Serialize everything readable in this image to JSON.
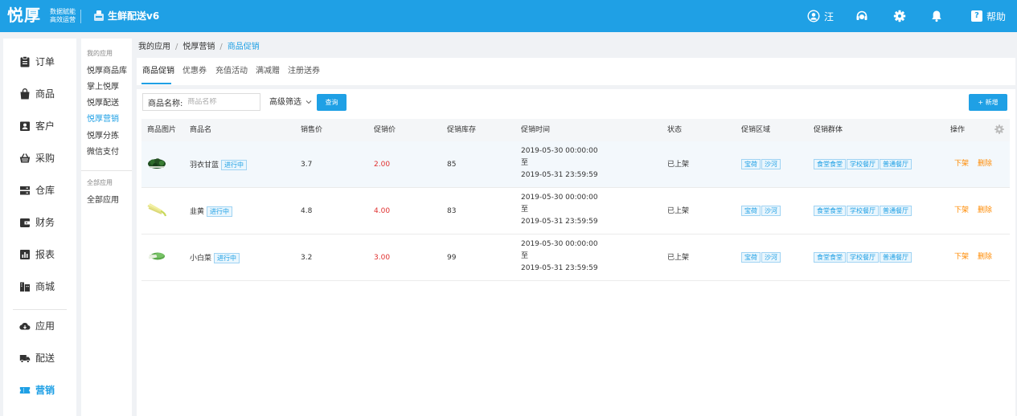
{
  "header": {
    "logo_text": "悦厚",
    "logo_slogan_1": "数据赋能",
    "logo_slogan_2": "高效运营",
    "app_title": "生鲜配送v6",
    "user_name": "汪",
    "help_label": "帮助",
    "help_badge": "?"
  },
  "sidebar": {
    "items": [
      {
        "label": "订单",
        "icon": "clipboard-icon"
      },
      {
        "label": "商品",
        "icon": "bag-icon"
      },
      {
        "label": "客户",
        "icon": "contact-card-icon"
      },
      {
        "label": "采购",
        "icon": "basket-icon"
      },
      {
        "label": "仓库",
        "icon": "warehouse-icon"
      },
      {
        "label": "财务",
        "icon": "wallet-icon"
      },
      {
        "label": "报表",
        "icon": "bar-chart-icon"
      },
      {
        "label": "商城",
        "icon": "store-icon"
      },
      {
        "label": "应用",
        "icon": "cloud-icon"
      },
      {
        "label": "配送",
        "icon": "truck-icon"
      },
      {
        "label": "营销",
        "icon": "ticket-icon"
      }
    ],
    "active": "营销"
  },
  "subnav": {
    "group_my": "我的应用",
    "my_items": [
      "悦厚商品库",
      "掌上悦厚",
      "悦厚配送",
      "悦厚营销",
      "悦厚分拣",
      "微信支付"
    ],
    "active": "悦厚营销",
    "group_all": "全部应用",
    "all_items": [
      "全部应用"
    ]
  },
  "breadcrumb": {
    "items": [
      "我的应用",
      "悦厚营销",
      "商品促销"
    ],
    "separator": "/"
  },
  "tabs": [
    "商品促销",
    "优惠券",
    "充值活动",
    "满减赠",
    "注册送券"
  ],
  "active_tab": "商品促销",
  "filter": {
    "name_label": "商品名称:",
    "name_placeholder": "商品名称",
    "advanced_label": "高级筛选",
    "query_button": "查询",
    "new_button": "+ 新增"
  },
  "table": {
    "columns": [
      "商品图片",
      "商品名",
      "销售价",
      "促销价",
      "促销库存",
      "促销时间",
      "状态",
      "促销区域",
      "促销群体",
      "操作"
    ],
    "rows": [
      {
        "image": "kale-image",
        "name": "羽衣甘蓝",
        "badge": "进行中",
        "sale_price": "3.7",
        "promo_price": "2.00",
        "stock": "85",
        "time_start": "2019-05-30 00:00:00",
        "time_to": "至",
        "time_end": "2019-05-31 23:59:59",
        "status": "已上架",
        "regions": [
          "宝荷",
          "沙河"
        ],
        "groups": [
          "食堂食堂",
          "学校餐厅",
          "普通餐厅"
        ],
        "op_down": "下架",
        "op_delete": "删除"
      },
      {
        "image": "chives-image",
        "name": "韭黄",
        "badge": "进行中",
        "sale_price": "4.8",
        "promo_price": "4.00",
        "stock": "83",
        "time_start": "2019-05-30 00:00:00",
        "time_to": "至",
        "time_end": "2019-05-31 23:59:59",
        "status": "已上架",
        "regions": [
          "宝荷",
          "沙河"
        ],
        "groups": [
          "食堂食堂",
          "学校餐厅",
          "普通餐厅"
        ],
        "op_down": "下架",
        "op_delete": "删除"
      },
      {
        "image": "bok-choy-image",
        "name": "小白菜",
        "badge": "进行中",
        "sale_price": "3.2",
        "promo_price": "3.00",
        "stock": "99",
        "time_start": "2019-05-30 00:00:00",
        "time_to": "至",
        "time_end": "2019-05-31 23:59:59",
        "status": "已上架",
        "regions": [
          "宝荷",
          "沙河"
        ],
        "groups": [
          "食堂食堂",
          "学校餐厅",
          "普通餐厅"
        ],
        "op_down": "下架",
        "op_delete": "删除"
      }
    ]
  },
  "colors": {
    "brand": "#1fa0e5",
    "promo_price": "#e0302f",
    "operation": "#ff8a00"
  }
}
